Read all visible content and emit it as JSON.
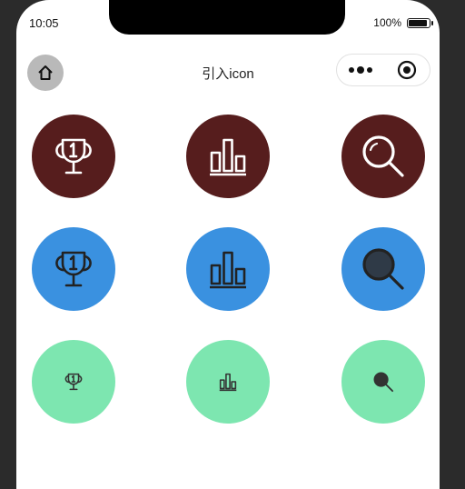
{
  "status": {
    "time": "10:05",
    "battery": "100%"
  },
  "nav": {
    "title": "引入icon"
  },
  "icons": {
    "rows": [
      {
        "color": "#561d1d",
        "icon_color": "#ffffff",
        "size": "large",
        "items": [
          "trophy-icon",
          "bar-chart-icon",
          "search-icon"
        ]
      },
      {
        "color": "#3a91e0",
        "icon_color": "#222222",
        "size": "large",
        "items": [
          "trophy-icon",
          "bar-chart-icon",
          "search-icon"
        ]
      },
      {
        "color": "#7de6b0",
        "icon_color": "#333333",
        "size": "small",
        "items": [
          "trophy-icon",
          "bar-chart-icon",
          "search-icon"
        ]
      }
    ]
  }
}
